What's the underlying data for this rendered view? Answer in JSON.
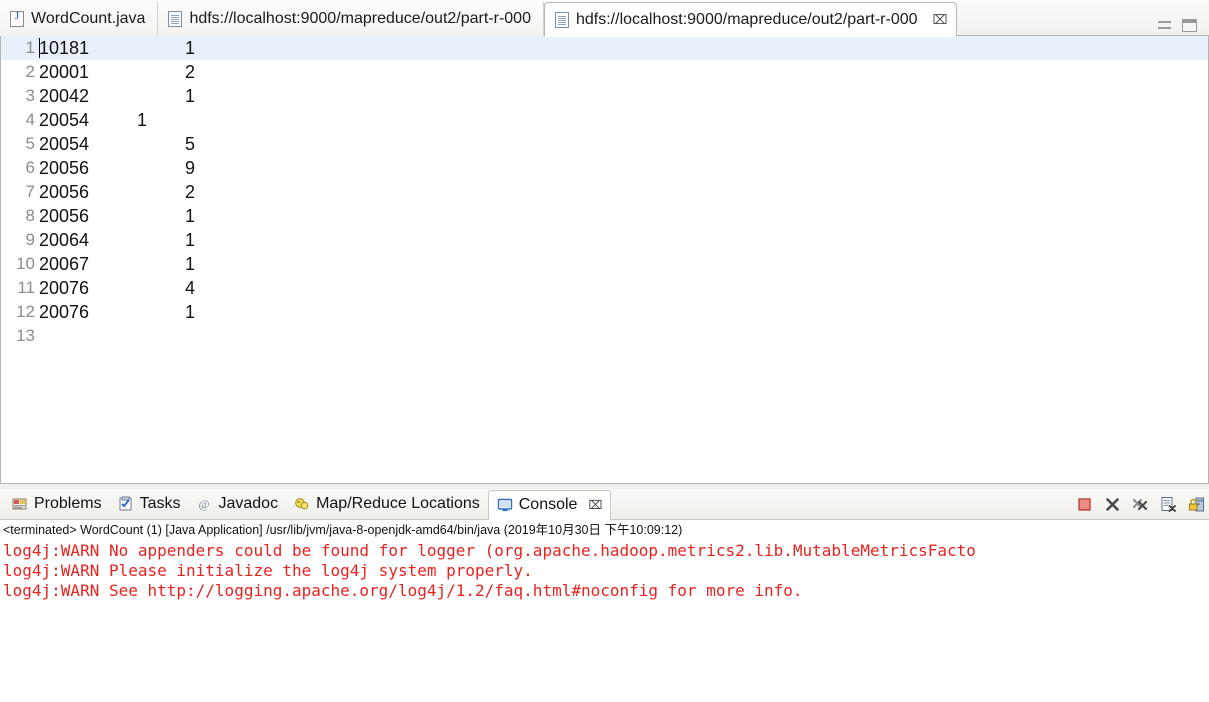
{
  "editor": {
    "tabs": [
      {
        "label": "WordCount.java",
        "icon": "java-file-icon",
        "active": false,
        "closable": false
      },
      {
        "label": "hdfs://localhost:9000/mapreduce/out2/part-r-000",
        "icon": "text-file-icon",
        "active": false,
        "closable": false
      },
      {
        "label": "hdfs://localhost:9000/mapreduce/out2/part-r-000",
        "icon": "text-file-icon",
        "active": true,
        "closable": true
      }
    ],
    "close_glyph": "⌧",
    "view_buttons": {
      "minimize": "Minimize",
      "maximize": "Maximize"
    },
    "current_line": 1,
    "lines": [
      {
        "n": "1",
        "key": "10181",
        "value": "1",
        "value_x": 148
      },
      {
        "n": "2",
        "key": "20001",
        "value": "2",
        "value_x": 148
      },
      {
        "n": "3",
        "key": "20042",
        "value": "1",
        "value_x": 148
      },
      {
        "n": "4",
        "key": "20054",
        "value": "1",
        "value_x": 100
      },
      {
        "n": "5",
        "key": "20054",
        "value": "5",
        "value_x": 148
      },
      {
        "n": "6",
        "key": "20056",
        "value": "9",
        "value_x": 148
      },
      {
        "n": "7",
        "key": "20056",
        "value": "2",
        "value_x": 148
      },
      {
        "n": "8",
        "key": "20056",
        "value": "1",
        "value_x": 148
      },
      {
        "n": "9",
        "key": "20064",
        "value": "1",
        "value_x": 148
      },
      {
        "n": "10",
        "key": "20067",
        "value": "1",
        "value_x": 148
      },
      {
        "n": "11",
        "key": "20076",
        "value": "4",
        "value_x": 148
      },
      {
        "n": "12",
        "key": "20076",
        "value": "1",
        "value_x": 148
      },
      {
        "n": "13",
        "key": "",
        "value": "",
        "value_x": 148
      }
    ]
  },
  "bottom_panel": {
    "tabs": [
      {
        "label": "Problems",
        "icon": "problems-icon",
        "active": false,
        "closable": false
      },
      {
        "label": "Tasks",
        "icon": "tasks-icon",
        "active": false,
        "closable": false
      },
      {
        "label": "Javadoc",
        "icon": "javadoc-icon",
        "active": false,
        "closable": false
      },
      {
        "label": "Map/Reduce Locations",
        "icon": "mapreduce-icon",
        "active": false,
        "closable": false
      },
      {
        "label": "Console",
        "icon": "console-icon",
        "active": true,
        "closable": true
      }
    ],
    "close_glyph": "⌧",
    "toolbar": [
      {
        "name": "terminate-button",
        "title": "Terminate"
      },
      {
        "name": "remove-launch-button",
        "title": "Remove Launch"
      },
      {
        "name": "remove-all-terminated-button",
        "title": "Remove All Terminated Launches"
      },
      {
        "name": "clear-console-button",
        "title": "Clear Console"
      },
      {
        "name": "scroll-lock-button",
        "title": "Scroll Lock"
      }
    ],
    "console": {
      "status": "<terminated> WordCount (1) [Java Application] /usr/lib/jvm/java-8-openjdk-amd64/bin/java (2019年10月30日 下午10:09:12)",
      "text_color": "#e8231f",
      "lines": [
        "log4j:WARN No appenders could be found for logger (org.apache.hadoop.metrics2.lib.MutableMetricsFacto",
        "log4j:WARN Please initialize the log4j system properly.",
        "log4j:WARN See http://logging.apache.org/log4j/1.2/faq.html#noconfig for more info."
      ]
    }
  },
  "colors": {
    "current_line_highlight": "#e8f1fb",
    "gutter_text": "#8d8d8d",
    "code_text": "#111111",
    "console_error": "#e8231f",
    "tab_border": "#b6b6b6"
  }
}
